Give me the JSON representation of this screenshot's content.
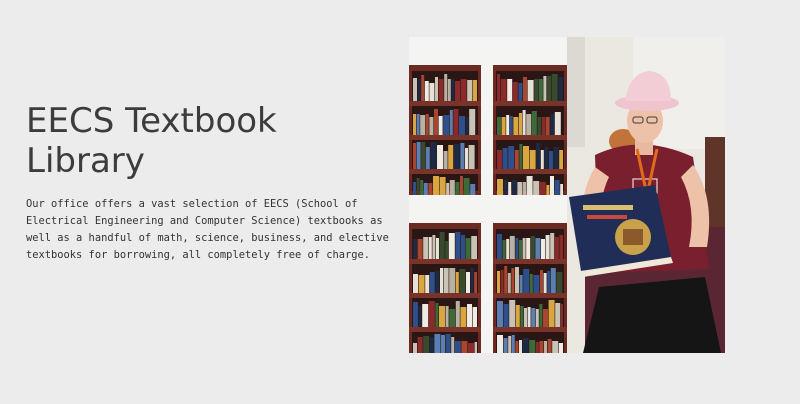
{
  "section": {
    "title": "EECS Textbook Library",
    "description": "Our office offers a vast selection of EECS (School of Electrical Engineering and Computer Science) textbooks as well as a handful of math, science, business, and elective textbooks for borrowing, all completely free of charge."
  },
  "photo": {
    "panels": [
      "bookshelf",
      "bookshelf",
      "reader"
    ]
  },
  "colors": {
    "background": "#ececec",
    "title": "#3c3c3c",
    "body_text": "#333333",
    "shelf_wood": "#6b2a22",
    "shirt": "#7a1f2e",
    "hat": "#efc4cf",
    "lanyard": "#e06a1c"
  }
}
